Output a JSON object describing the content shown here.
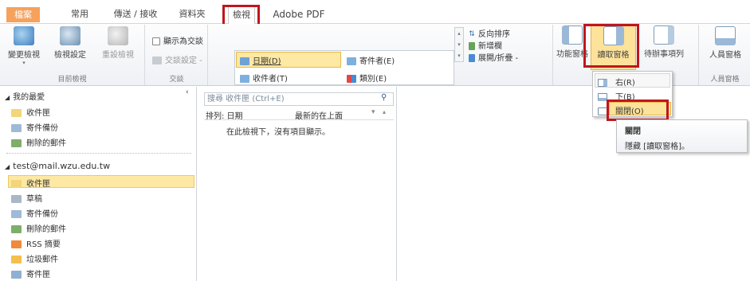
{
  "tabs": {
    "file": "檔案",
    "home": "常用",
    "send_receive": "傳送 / 接收",
    "folder": "資料夾",
    "view": "檢視",
    "adobe": "Adobe PDF"
  },
  "ribbon": {
    "current_view": {
      "change_view": "變更檢視",
      "view_settings": "檢視設定",
      "reset_view": "重設檢視",
      "group_label": "目前檢視"
    },
    "conversations": {
      "show_as_conversations": "顯示為交談",
      "conversation_settings": "交談設定 -",
      "group_label": "交談"
    },
    "arrangement": {
      "date": "日期(D)",
      "sender": "寄件者(E)",
      "recipient": "收件者(T)",
      "category": "類別(E)",
      "reverse_sort": "反向排序",
      "add_columns": "新增欄",
      "expand_collapse": "展開/折疊 -",
      "group_label": "排列方式"
    },
    "layout": {
      "folder_pane": "功能窗格",
      "reading_pane": "讀取窗格",
      "todo_bar": "待辦事項列",
      "group_label": ""
    },
    "people": {
      "people_pane": "人員窗格",
      "group_label": "人員窗格"
    }
  },
  "navigation": {
    "favorites_header": "我的最愛",
    "favorites": [
      "收件匣",
      "寄件備份",
      "刪除的郵件"
    ],
    "account": "test@mail.wzu.edu.tw",
    "account_folders": [
      "收件匣",
      "草稿",
      "寄件備份",
      "刪除的郵件",
      "RSS 摘要",
      "垃圾郵件",
      "寄件匣"
    ]
  },
  "message_list": {
    "search_placeholder": "搜尋 收件匣 (Ctrl+E)",
    "arrange_by": "排列: 日期",
    "newest_on_top": "最新的在上面",
    "empty_message": "在此檢視下，沒有項目顯示。"
  },
  "reading_pane_menu": {
    "right": "右(R)",
    "bottom": "下(B)",
    "off": "關閉(O)"
  },
  "tooltip": {
    "title": "關閉",
    "description": "隱藏 [讀取窗格]。"
  }
}
